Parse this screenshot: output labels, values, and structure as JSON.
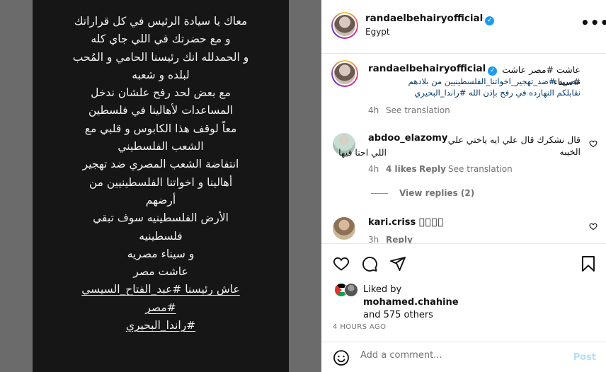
{
  "story": {
    "lines": [
      "معاك يا سيادة الرئيس في كل قراراتك",
      "و مع حضرتك في اللي جاي كله",
      "و الحمدلله انك رئيسنا الحامي و المُحب",
      "لبلده و شعبه",
      "مع بعض لحد رفح علشان ندخل",
      "المساعدات لأهالينا في فلسطين",
      "معاً لوقف هذا الكابوس و قلبي مع",
      "الشعب الفلسطيني",
      "انتفاضة الشعب المصري ضد تهجير",
      "أهالينا و اخواتنا الفلسطينيين من",
      "أرضهم",
      "الأرض الفلسطينيه سوف تبقي",
      "فلسطينيه",
      "و سيناء مصريه",
      "عاشت مصر",
      "عاش رئيسنا #عبد_الفتاح_السيسي",
      "#مصر",
      "#راندا_البحيري"
    ]
  },
  "header": {
    "username": "randaelbehairyofficial",
    "location": "Egypt",
    "more_icon": "•••"
  },
  "caption": {
    "username": "randaelbehairyofficial",
    "line1": "عاشت #مصر عاشت #سيناء",
    "line2": "مصريه #ضد_تهجير_اخواتنا_الفلسطينيين من بلادهم",
    "line3": "نقابلكم النهارده في رفح بإذن الله #راندا_البحيري",
    "time": "4h",
    "see_translation": "See translation"
  },
  "comments": [
    {
      "username": "abdoo_elazomy",
      "text_line1": "قال نشكرك قال علي ايه ياختي علي الخيبه",
      "text_line2": "اللي احنا فيها",
      "time": "4h",
      "likes": "4 likes",
      "reply": "Reply",
      "see_translation": "See translation",
      "view_replies": "View replies (2)"
    },
    {
      "username": "kari.criss",
      "text": "\u0000\u0000\u0000\u0000",
      "time": "3h",
      "reply": "Reply"
    }
  ],
  "liked": {
    "prefix": "Liked by",
    "user": "mohamed.chahine",
    "others": "and 575 others",
    "timestamp": "4 HOURS AGO"
  },
  "add_comment": {
    "placeholder": "Add a comment...",
    "post_label": "Post"
  },
  "colors": {
    "accent_link": "#00376b",
    "post_disabled": "#b2dffc",
    "verified": "#1d9bf0"
  }
}
